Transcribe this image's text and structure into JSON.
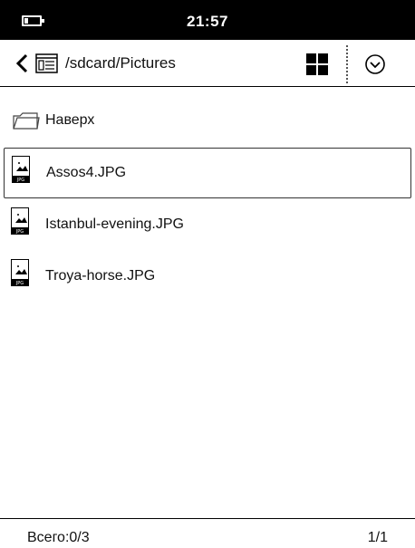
{
  "status_bar": {
    "time": "21:57"
  },
  "toolbar": {
    "path": "/sdcard/Pictures"
  },
  "list": {
    "up": {
      "label": "Наверх"
    },
    "files": [
      {
        "name": "Assos4.JPG",
        "selected": true
      },
      {
        "name": "Istanbul-evening.JPG",
        "selected": false
      },
      {
        "name": "Troya-horse.JPG",
        "selected": false
      }
    ],
    "file_badge": "JPG"
  },
  "footer": {
    "total": "Всего:0/3",
    "page": "1/1"
  },
  "icons": {
    "back": "chevron-left-icon",
    "folder": "folder-list-icon",
    "grid": "grid-view-icon",
    "select": "check-circle-icon",
    "file": "image-file-icon",
    "up": "folder-up-icon",
    "battery": "battery-icon"
  }
}
